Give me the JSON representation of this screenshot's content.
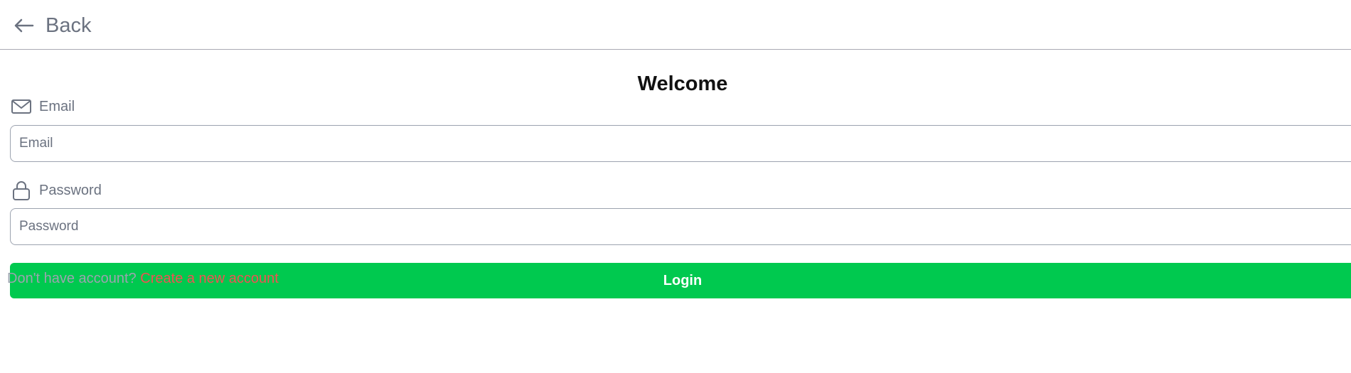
{
  "header": {
    "back_label": "Back",
    "back_icon": "arrow-left-icon"
  },
  "form": {
    "title": "Welcome",
    "email": {
      "label": "Email",
      "icon": "mail-icon",
      "placeholder": "Email",
      "value": ""
    },
    "password": {
      "label": "Password",
      "icon": "lock-icon",
      "placeholder": "Password",
      "value": ""
    },
    "login_label": "Login",
    "signup_prompt": "Don't have account?",
    "signup_link": "Create a new account"
  },
  "colors": {
    "accent_green": "#00c94f",
    "link_red": "#f05252",
    "muted_gray": "#6b7280"
  }
}
